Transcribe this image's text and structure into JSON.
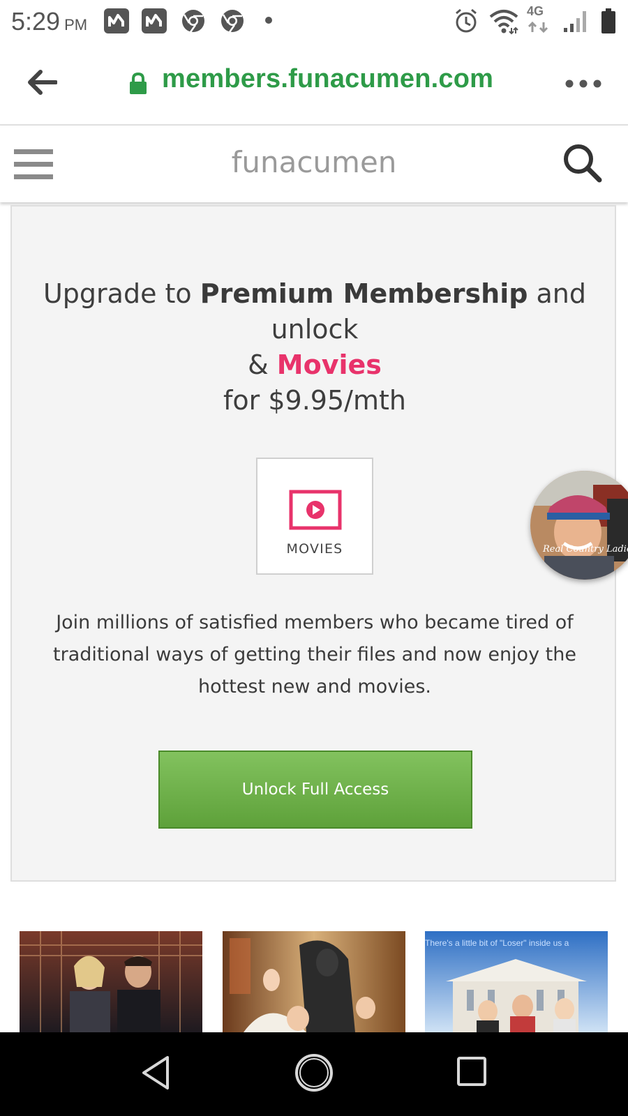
{
  "status_bar": {
    "time": "5:29",
    "ampm": "PM",
    "network": "4G"
  },
  "browser": {
    "url": "members.funacumen.com",
    "url_color": "#2e9b48"
  },
  "site": {
    "brand": "funacumen"
  },
  "promo": {
    "headline_prefix": "Upgrade to ",
    "headline_bold": "Premium Membership",
    "headline_mid": " and unlock",
    "headline_amp": "& ",
    "headline_highlight": "Movies",
    "headline_price": "for $9.95/mth",
    "highlight_color": "#e8336b",
    "category_label": "MOVIES",
    "category_icon": "play-video-icon",
    "description": "Join millions of satisfied members who became tired of traditional ways of getting their files and now enjoy the hottest new and movies.",
    "cta_label": "Unlock Full Access",
    "cta_color": "#6aac45"
  },
  "floating_avatar": {
    "caption": "Real Country Ladies"
  },
  "thumbnails": {
    "third_caption": "There's a little bit of \"Loser\" inside us a"
  },
  "nav": {
    "icons": [
      "back-triangle-icon",
      "home-circle-icon",
      "recents-square-icon"
    ]
  }
}
